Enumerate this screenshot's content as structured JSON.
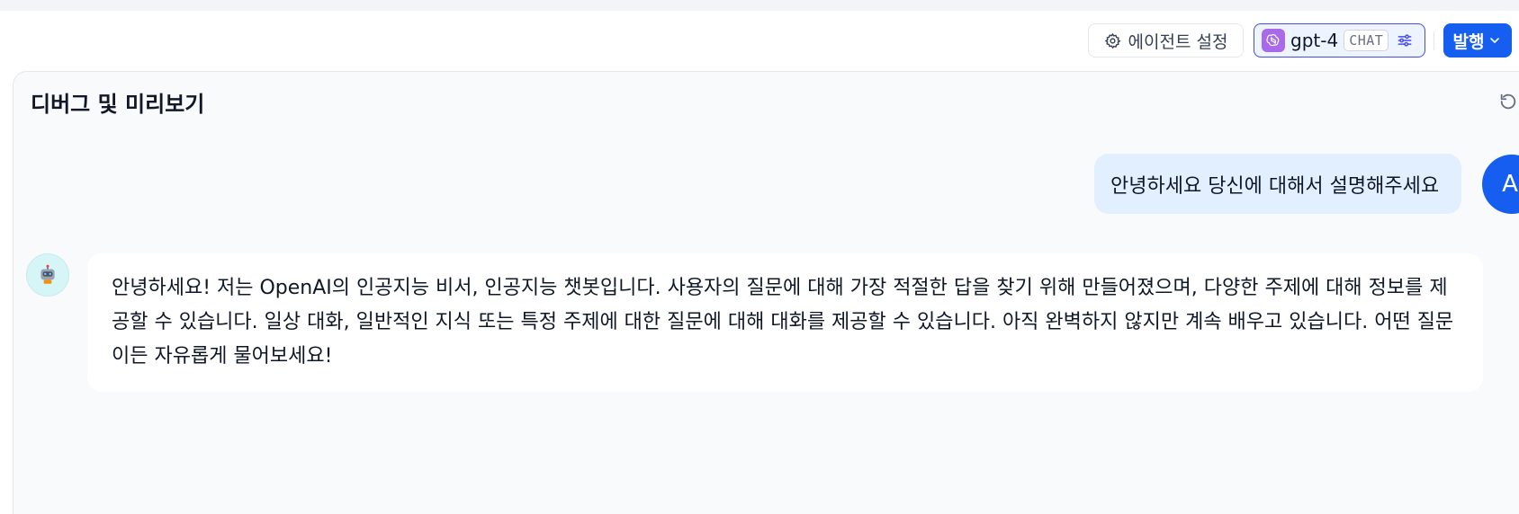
{
  "toolbar": {
    "agent_settings_label": "에이전트 설정",
    "model": {
      "name": "gpt-4",
      "badge": "CHAT",
      "logo_color": "#a86ae8"
    },
    "publish_label": "발행"
  },
  "preview": {
    "title": "디버그 및 미리보기",
    "messages": [
      {
        "role": "user",
        "avatar_initial": "A",
        "text": "안녕하세요 당신에 대해서 설명해주세요"
      },
      {
        "role": "assistant",
        "avatar": "robot-icon",
        "text": "안녕하세요! 저는 OpenAI의 인공지능 비서, 인공지능 챗봇입니다. 사용자의 질문에 대해 가장 적절한 답을 찾기 위해 만들어졌으며, 다양한 주제에 대해 정보를 제공할 수 있습니다. 일상 대화, 일반적인 지식 또는 특정 주제에 대한 질문에 대해 대화를 제공할 수 있습니다. 아직 완벽하지 않지만 계속 배우고 있습니다. 어떤 질문이든 자유롭게 물어보세요!"
      }
    ]
  },
  "colors": {
    "accent": "#155eef",
    "user_bubble": "#e1effe",
    "panel_bg": "#f9fafb"
  }
}
